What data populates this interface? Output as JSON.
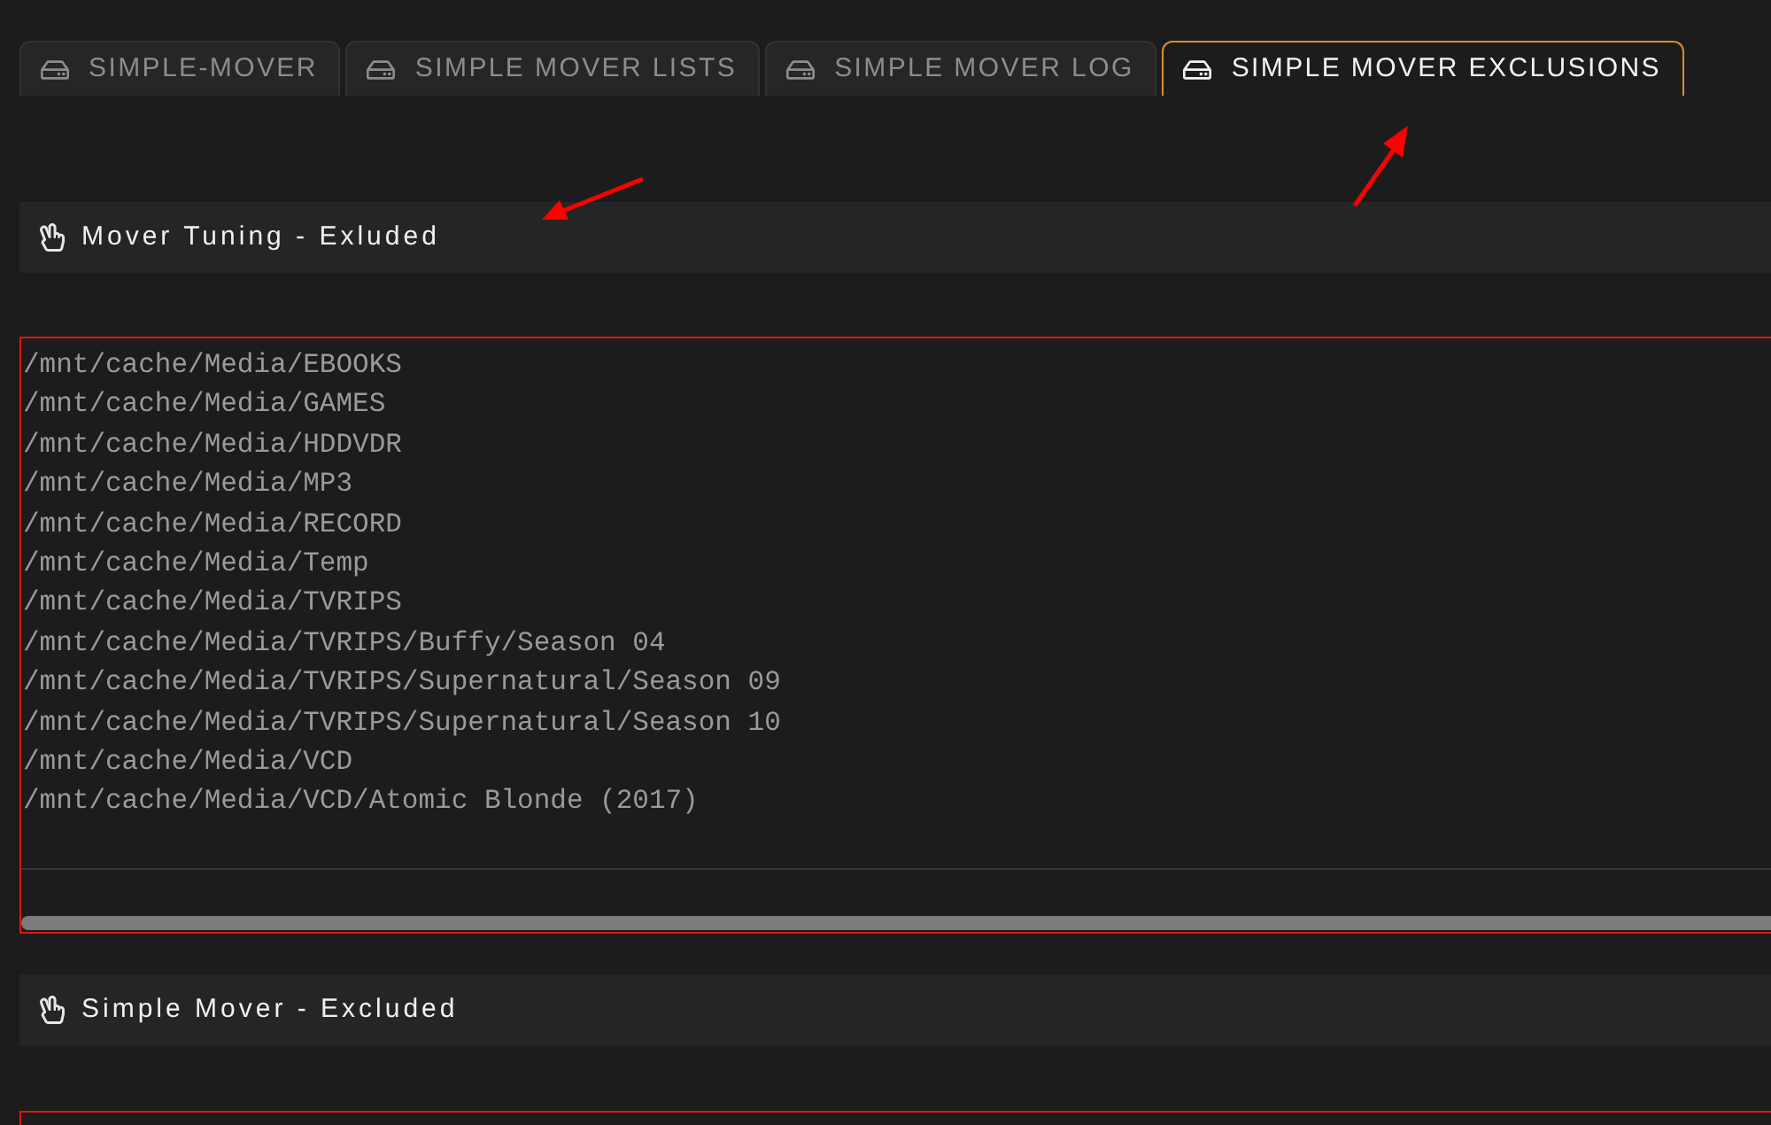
{
  "tabs": [
    {
      "label": "SIMPLE-MOVER",
      "selected": false
    },
    {
      "label": "SIMPLE MOVER LISTS",
      "selected": false
    },
    {
      "label": "SIMPLE MOVER LOG",
      "selected": false
    },
    {
      "label": "SIMPLE MOVER EXCLUSIONS",
      "selected": true
    }
  ],
  "sections": [
    {
      "title": "Mover Tuning - Exluded",
      "excluded_paths": [
        "/mnt/cache/Media/EBOOKS",
        "/mnt/cache/Media/GAMES",
        "/mnt/cache/Media/HDDVDR",
        "/mnt/cache/Media/MP3",
        "/mnt/cache/Media/RECORD",
        "/mnt/cache/Media/Temp",
        "/mnt/cache/Media/TVRIPS",
        "/mnt/cache/Media/TVRIPS/Buffy/Season 04",
        "/mnt/cache/Media/TVRIPS/Supernatural/Season 09",
        "/mnt/cache/Media/TVRIPS/Supernatural/Season 10",
        "/mnt/cache/Media/VCD",
        "/mnt/cache/Media/VCD/Atomic Blonde (2017)"
      ]
    },
    {
      "title": "Simple Mover - Excluded"
    }
  ]
}
